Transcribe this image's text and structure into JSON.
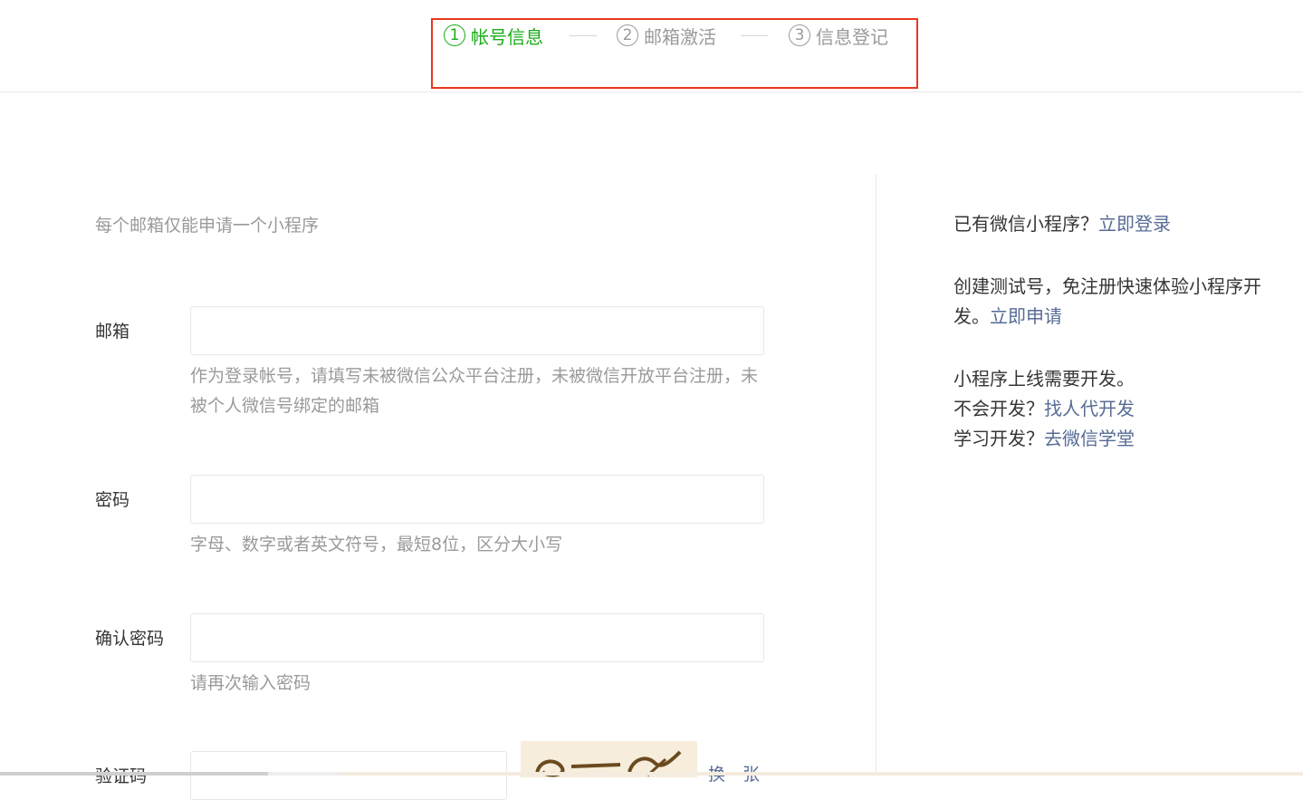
{
  "steps": [
    {
      "num": "1",
      "label": "帐号信息",
      "state": "active"
    },
    {
      "num": "2",
      "label": "邮箱激活",
      "state": "inactive"
    },
    {
      "num": "3",
      "label": "信息登记",
      "state": "inactive"
    }
  ],
  "form": {
    "tips": "每个邮箱仅能申请一个小程序",
    "email": {
      "label": "邮箱",
      "value": "",
      "hint": "作为登录帐号，请填写未被微信公众平台注册，未被微信开放平台注册，未被个人微信号绑定的邮箱"
    },
    "password": {
      "label": "密码",
      "value": "",
      "hint": "字母、数字或者英文符号，最短8位，区分大小写"
    },
    "confirm_password": {
      "label": "确认密码",
      "value": "",
      "hint": "请再次输入密码"
    },
    "captcha": {
      "label": "验证码",
      "value": "",
      "change": "换一张"
    }
  },
  "sidebar": {
    "existing_text": "已有微信小程序？",
    "login_link": "立即登录",
    "test_text": "创建测试号，免注册快速体验小程序开发。",
    "apply_link": "立即申请",
    "dev_line1": "小程序上线需要开发。",
    "no_dev_text": "不会开发？",
    "find_dev_link": "找人代开发",
    "learn_text": "学习开发？",
    "school_link": "去微信学堂"
  },
  "colors": {
    "active": "#1aad19",
    "inactive": "#9a9a9a",
    "link": "#576b95",
    "highlight_border": "#e8361f"
  }
}
